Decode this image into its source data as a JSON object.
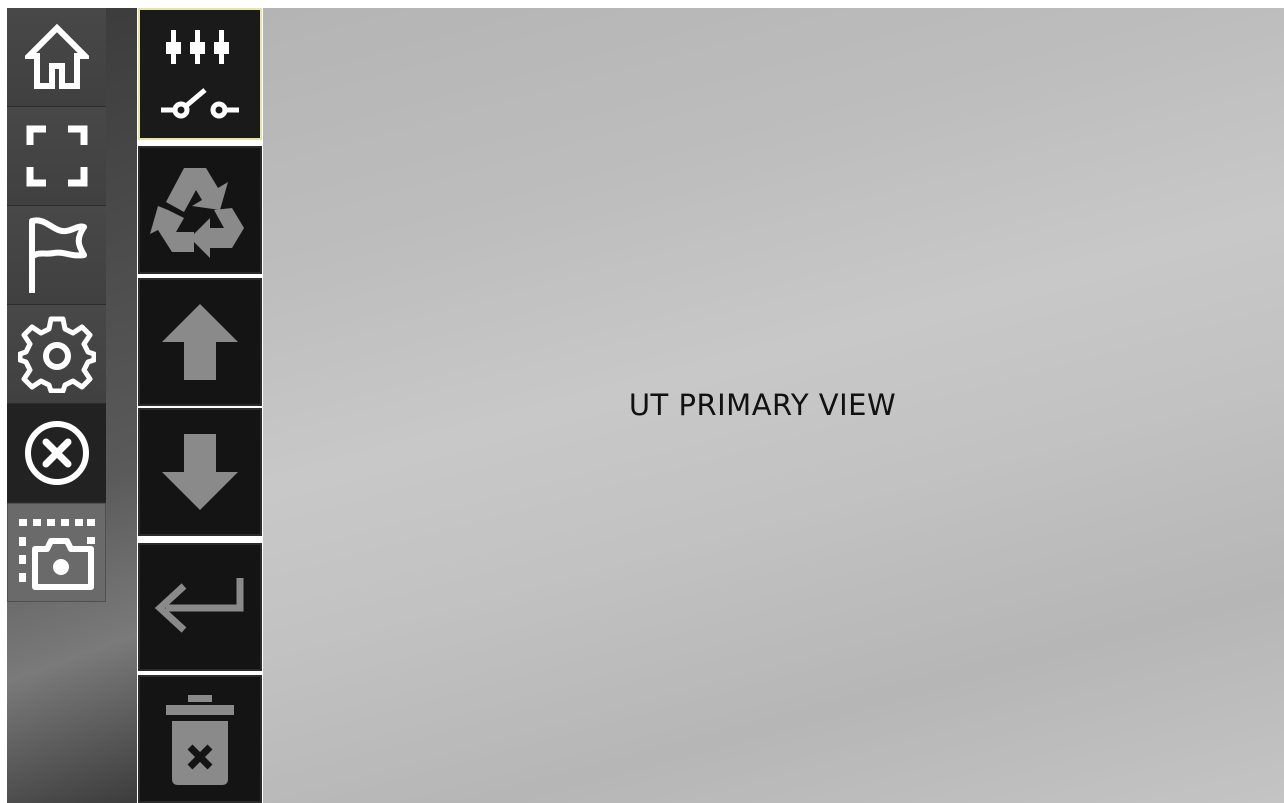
{
  "main_view": {
    "title": "UT PRIMARY VIEW"
  },
  "nav_rail": {
    "items": [
      {
        "icon": "home-icon",
        "state": "normal"
      },
      {
        "icon": "fullscreen-icon",
        "state": "normal"
      },
      {
        "icon": "flag-icon",
        "state": "normal"
      },
      {
        "icon": "settings-gear-icon",
        "state": "normal"
      },
      {
        "icon": "close-circle-icon",
        "state": "active"
      },
      {
        "icon": "screenshot-camera-icon",
        "state": "normal"
      }
    ]
  },
  "tool_column": {
    "items": [
      {
        "icon": "switch-connector-icon",
        "state": "selected",
        "enabled": true
      },
      {
        "icon": "recycle-icon",
        "state": "normal",
        "enabled": false
      },
      {
        "icon": "arrow-up-icon",
        "state": "normal",
        "enabled": false
      },
      {
        "icon": "arrow-down-icon",
        "state": "normal",
        "enabled": false
      },
      {
        "icon": "enter-return-icon",
        "state": "normal",
        "enabled": false
      },
      {
        "icon": "trash-delete-icon",
        "state": "normal",
        "enabled": false
      }
    ]
  },
  "colors": {
    "icon_active": "#ffffff",
    "icon_disabled": "#8a8a8a",
    "selected_border": "#e8e4a8",
    "view_text": "#111111"
  }
}
